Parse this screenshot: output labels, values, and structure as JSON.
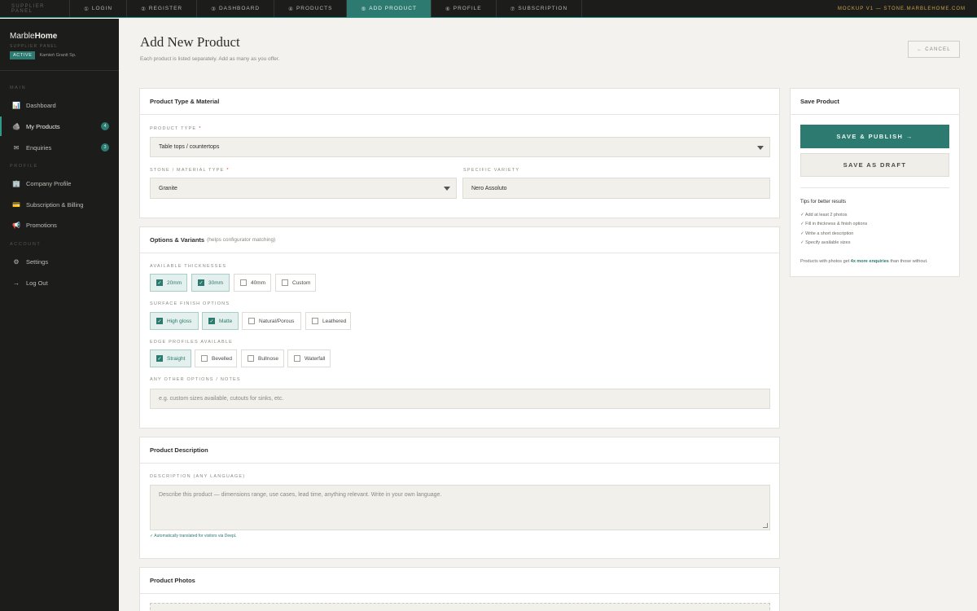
{
  "topbar": {
    "brand": "Supplier Panel",
    "tabs": [
      {
        "step": "①",
        "label": "LOGIN"
      },
      {
        "step": "②",
        "label": "REGISTER"
      },
      {
        "step": "③",
        "label": "DASHBOARD"
      },
      {
        "step": "④",
        "label": "PRODUCTS"
      },
      {
        "step": "⑤",
        "label": "ADD PRODUCT"
      },
      {
        "step": "⑥",
        "label": "PROFILE"
      },
      {
        "step": "⑦",
        "label": "SUBSCRIPTION"
      }
    ],
    "right_text": "MOCKUP V1 — STONE.MARBLEHOME.COM"
  },
  "sidebar": {
    "logo_light": "Marble",
    "logo_bold": "Home",
    "panel_label": "SUPPLIER PANEL",
    "status": "ACTIVE",
    "company": "Kamień Granit Sp.",
    "sections": {
      "main": "MAIN",
      "profile": "PROFILE",
      "account": "ACCOUNT"
    },
    "items": [
      {
        "label": "Dashboard",
        "icon": "📊"
      },
      {
        "label": "My Products",
        "icon": "🪨",
        "count": "4"
      },
      {
        "label": "Enquiries",
        "icon": "✉",
        "count": "3"
      },
      {
        "label": "Company Profile",
        "icon": "🏢"
      },
      {
        "label": "Subscription & Billing",
        "icon": "💳"
      },
      {
        "label": "Promotions",
        "icon": "📢"
      },
      {
        "label": "Settings",
        "icon": "⚙"
      },
      {
        "label": "Log Out",
        "icon": "→"
      }
    ]
  },
  "header": {
    "title": "Add New Product",
    "subtitle": "Each product is listed separately. Add as many as you offer.",
    "cancel_label": "← CANCEL"
  },
  "type_card": {
    "title": "Product Type & Material",
    "product_type_label": "PRODUCT TYPE",
    "product_type_value": "Table tops / countertops",
    "material_label": "STONE / MATERIAL TYPE",
    "material_value": "Granite",
    "variety_label": "SPECIFIC VARIETY",
    "variety_value": "Nero Assoluto",
    "required_mark": "*"
  },
  "options_card": {
    "title": "Options & Variants",
    "hint": "(helps configurator matching)",
    "thickness_label": "AVAILABLE THICKNESSES",
    "thicknesses": [
      {
        "label": "20mm",
        "checked": true
      },
      {
        "label": "30mm",
        "checked": true
      },
      {
        "label": "40mm",
        "checked": false
      },
      {
        "label": "Custom",
        "checked": false
      }
    ],
    "finish_label": "SURFACE FINISH OPTIONS",
    "finishes": [
      {
        "label": "High gloss",
        "checked": true
      },
      {
        "label": "Matte",
        "checked": true
      },
      {
        "label": "Natural/Porous",
        "checked": false
      },
      {
        "label": "Leathered",
        "checked": false
      }
    ],
    "edge_label": "EDGE PROFILES AVAILABLE",
    "edges": [
      {
        "label": "Straight",
        "checked": true
      },
      {
        "label": "Bevelled",
        "checked": false
      },
      {
        "label": "Bullnose",
        "checked": false
      },
      {
        "label": "Waterfall",
        "checked": false
      }
    ],
    "notes_label": "ANY OTHER OPTIONS / NOTES",
    "notes_placeholder": "e.g. custom sizes available, cutouts for sinks, etc."
  },
  "description_card": {
    "title": "Product Description",
    "label": "DESCRIPTION (ANY LANGUAGE)",
    "placeholder": "Describe this product — dimensions range, use cases, lead time, anything relevant. Write in your own language.",
    "translated_note": "✓ Automatically translated for visitors via DeepL"
  },
  "photos_card": {
    "title": "Product Photos"
  },
  "save_card": {
    "title": "Save Product",
    "publish_label": "SAVE & PUBLISH →",
    "draft_label": "SAVE AS DRAFT",
    "tips_title": "Tips for better results",
    "tips": [
      "✓ Add at least 2 photos",
      "✓ Fill in thickness & finish options",
      "✓ Write a short description",
      "✓ Specify available sizes"
    ],
    "foot_before": "Products with photos get ",
    "foot_highlight": "4x more enquiries",
    "foot_after": " than those without."
  },
  "colors": {
    "accent": "#2c7a70",
    "sidebar_bg": "#1c1c1b",
    "page_bg": "#f3f2ee",
    "topbar_right": "#c9a24a"
  }
}
